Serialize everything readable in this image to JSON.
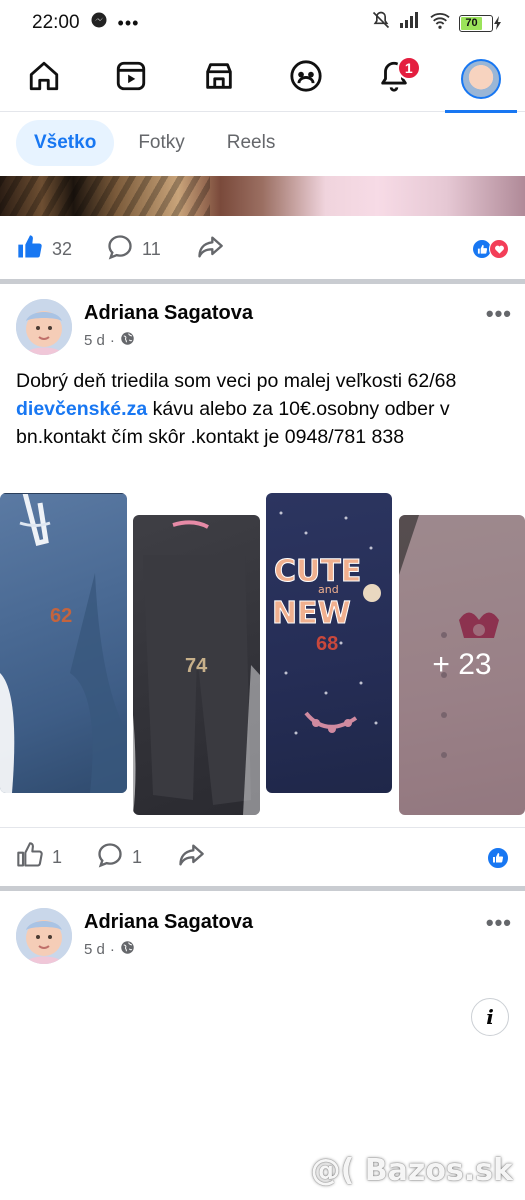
{
  "status_bar": {
    "time": "22:00",
    "battery": "70"
  },
  "top_nav": {
    "notification_count": "1"
  },
  "tabs": [
    "Všetko",
    "Fotky",
    "Reels"
  ],
  "prev_post": {
    "like_count": "32",
    "comment_count": "11"
  },
  "post": {
    "author": "Adriana Sagatova",
    "time": "5 d",
    "text_before": "Dobrý deň triedila som veci po malej  veľkosti 62/68 ",
    "tag": "dievčenské.za",
    "text_after": " kávu alebo za 10€.osobny odber v bn.kontakt čím skôr .kontakt je 0948/781 838",
    "photo_labels": [
      "62",
      "74",
      "68"
    ],
    "more_photos": "+ 23",
    "like_count": "1",
    "comment_count": "1"
  },
  "next_post": {
    "author": "Adriana Sagatova",
    "time": "5 d"
  },
  "watermark": "@( Bazos.sk",
  "colors": {
    "accent": "#1877f2",
    "badge": "#e41e3f",
    "love": "#f33e58"
  }
}
